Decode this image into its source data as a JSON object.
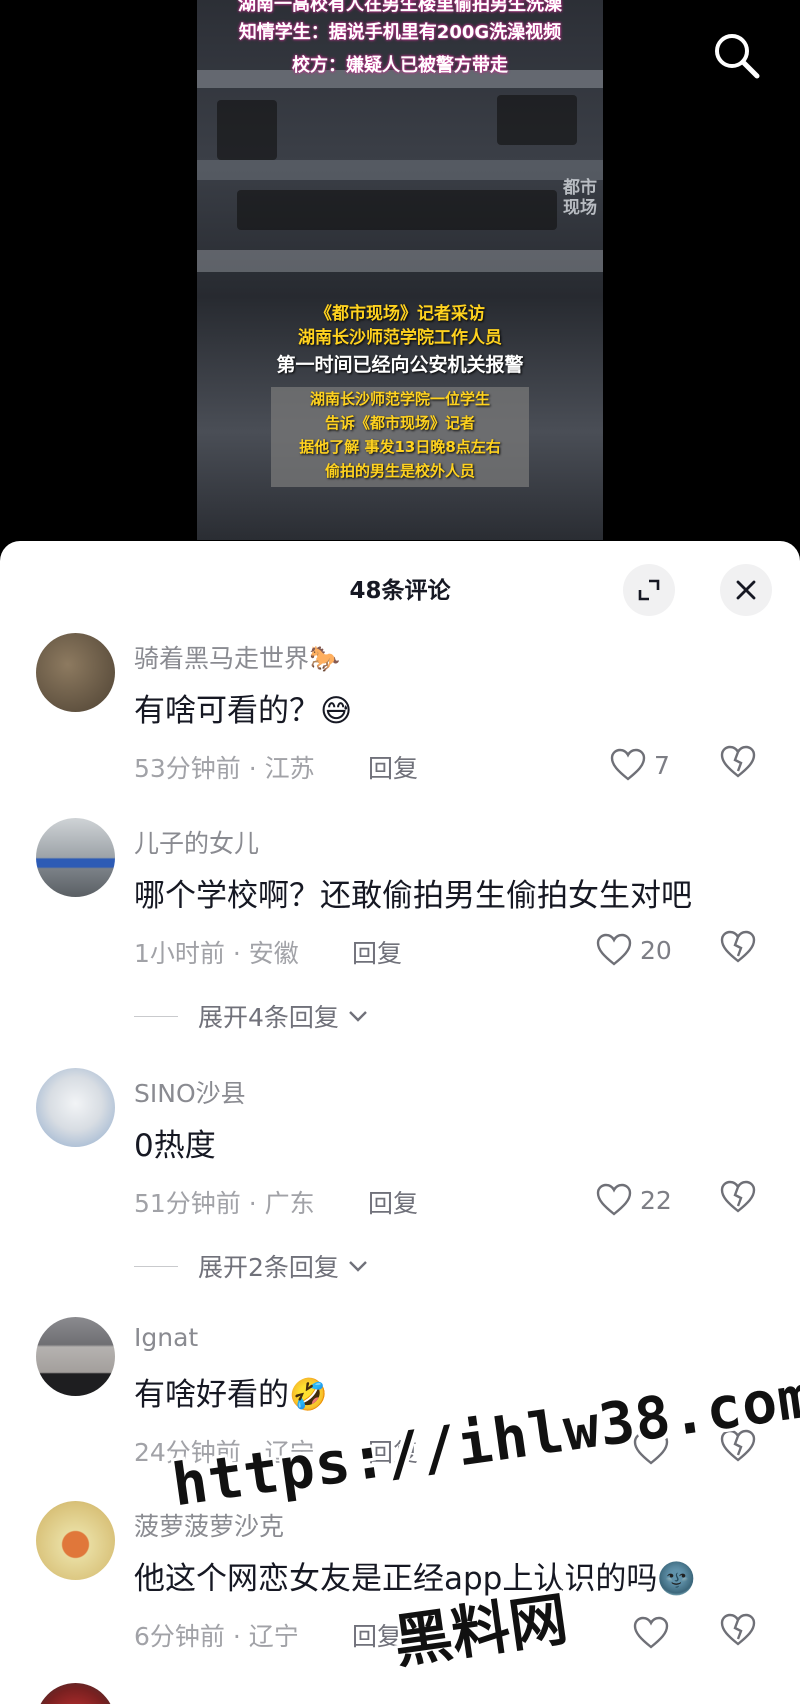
{
  "video": {
    "top_captions": [
      "湖南一高校有人在男生楼里偷拍男生洗澡",
      "知情学生：据说手机里有200G洗澡视频",
      "校方：嫌疑人已被警方带走"
    ],
    "mid_captions_yellow": [
      "《都市现场》记者采访",
      "湖南长沙师范学院工作人员"
    ],
    "mid_caption_white": "第一时间已经向公安机关报警",
    "box_captions": [
      "湖南长沙师范学院一位学生",
      "告诉《都市现场》记者",
      "据他了解 事发13日晚8点左右",
      "偷拍的男生是校外人员"
    ],
    "channel_logo": [
      "都市",
      "现场"
    ]
  },
  "sheet": {
    "title": "48条评论",
    "expand_icon": "expand-icon",
    "close_icon": "close-icon"
  },
  "comments": [
    {
      "user": "骑着黑马走世界🐎",
      "text": "有啥可看的？😅",
      "time": "53分钟前 · 江苏",
      "reply": "回复",
      "likes": "7",
      "avatar_color": "#6b5a45"
    },
    {
      "user": "儿子的女儿",
      "text": "哪个学校啊？还敢偷拍男生偷拍女生对吧",
      "time": "1小时前 · 安徽",
      "reply": "回复",
      "likes": "20",
      "expand": "展开4条回复",
      "avatar_color": "#8f959c"
    },
    {
      "user": "SINO沙县",
      "text": "0热度",
      "time": "51分钟前 · 广东",
      "reply": "回复",
      "likes": "22",
      "expand": "展开2条回复",
      "avatar_color": "#b9c6d6"
    },
    {
      "user": "Ignat",
      "text": "有啥好看的🤣",
      "time": "24分钟前 · 辽宁",
      "reply": "回复",
      "likes": "",
      "avatar_color": "#6f6f73"
    },
    {
      "user": "菠萝菠萝沙克",
      "text": "他这个网恋女友是正经app上认识的吗🌚",
      "time": "6分钟前 · 辽宁",
      "reply": "回复",
      "likes": "",
      "avatar_color": "#d9c27a"
    }
  ],
  "watermark": {
    "url": "https://ihlw38.com",
    "name": "黑料网"
  }
}
